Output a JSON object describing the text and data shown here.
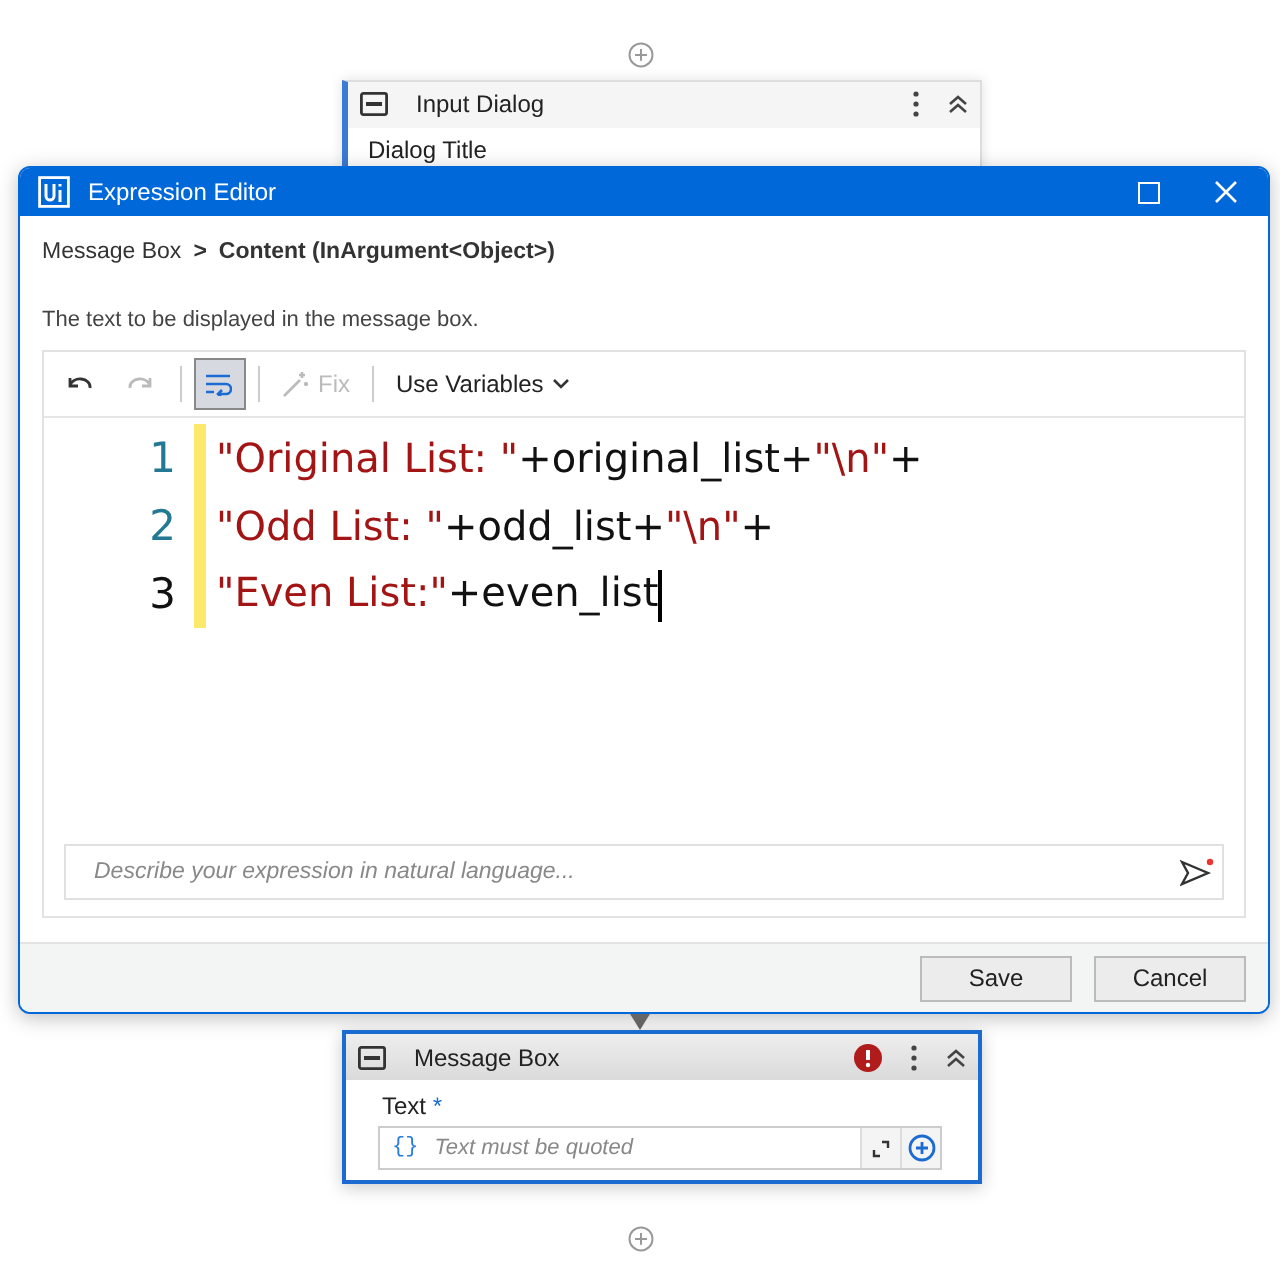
{
  "top_card": {
    "title": "Input Dialog",
    "field_label": "Dialog Title"
  },
  "dialog": {
    "title": "Expression Editor",
    "breadcrumb": {
      "parent": "Message Box",
      "separator": ">",
      "current": "Content (InArgument<Object>)"
    },
    "description": "The text to be displayed in the message box.",
    "toolbar": {
      "word_wrap_on": true,
      "redo_disabled": true,
      "fix_label": "Fix",
      "fix_disabled": true,
      "variables_label": "Use Variables"
    },
    "lines": [
      {
        "number": "1",
        "current": false,
        "tokens": [
          {
            "kind": "string",
            "text": "\"Original List: \""
          },
          {
            "kind": "code",
            "text": "+original_list+"
          },
          {
            "kind": "string",
            "text": "\"\\n\""
          },
          {
            "kind": "code",
            "text": "+"
          }
        ]
      },
      {
        "number": "2",
        "current": false,
        "tokens": [
          {
            "kind": "string",
            "text": "\"Odd List: \""
          },
          {
            "kind": "code",
            "text": "+odd_list+"
          },
          {
            "kind": "string",
            "text": "\"\\n\""
          },
          {
            "kind": "code",
            "text": "+"
          }
        ]
      },
      {
        "number": "3",
        "current": true,
        "tokens": [
          {
            "kind": "string",
            "text": "\"Even List:\""
          },
          {
            "kind": "code",
            "text": "+even_list"
          }
        ]
      }
    ],
    "prompt": {
      "placeholder": "Describe your expression in natural language..."
    },
    "buttons": [
      "Save",
      "Cancel"
    ]
  },
  "bottom_card": {
    "title": "Message Box",
    "has_error": true,
    "field_label": "Text",
    "required_mark": "*",
    "brace": "{}",
    "placeholder": "Text must be quoted"
  }
}
